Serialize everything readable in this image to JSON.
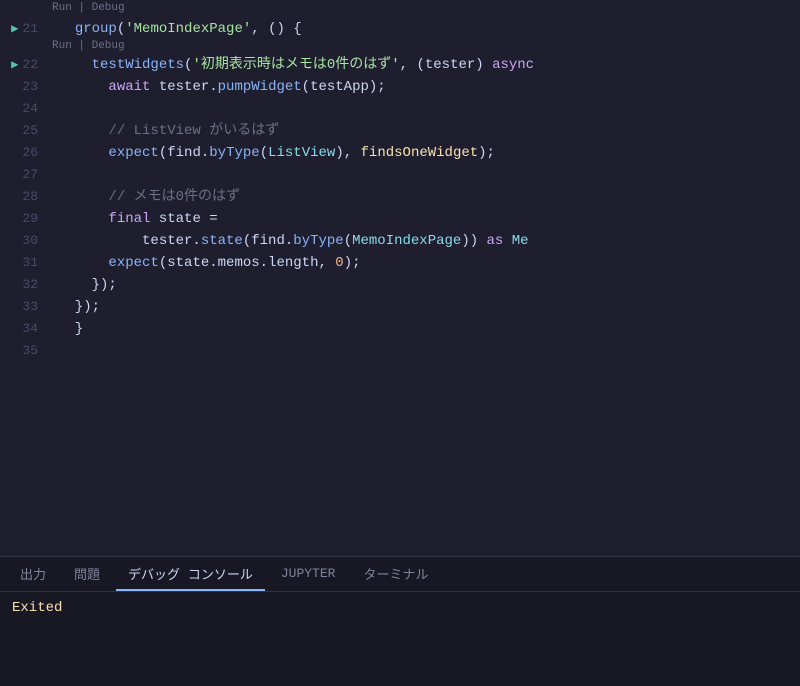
{
  "editor": {
    "lines": [
      {
        "number": 21,
        "hasArrow": true,
        "hasRunDebug": true,
        "runDebugText": "Run | Debug",
        "runDebugOffset": "above",
        "indent": 1,
        "tokens": [
          {
            "text": "group",
            "class": "kw-func"
          },
          {
            "text": "(",
            "class": "kw-paren"
          },
          {
            "text": "'MemoIndexPage'",
            "class": "kw-string"
          },
          {
            "text": ", () {",
            "class": "kw-plain"
          }
        ]
      },
      {
        "number": 22,
        "hasArrow": true,
        "hasRunDebug": true,
        "runDebugText": "Run | Debug",
        "indent": 2,
        "tokens": [
          {
            "text": "testWidgets",
            "class": "kw-func"
          },
          {
            "text": "(",
            "class": "kw-paren"
          },
          {
            "text": "'初期表示時はメモは0件のはず'",
            "class": "kw-string"
          },
          {
            "text": ", (tester) async",
            "class": "kw-plain kw-async"
          }
        ]
      },
      {
        "number": 23,
        "indent": 3,
        "tokens": [
          {
            "text": "await",
            "class": "kw-await"
          },
          {
            "text": " tester.",
            "class": "kw-tester"
          },
          {
            "text": "pumpWidget",
            "class": "kw-method"
          },
          {
            "text": "(testApp);",
            "class": "kw-plain"
          }
        ]
      },
      {
        "number": 24,
        "indent": 0,
        "tokens": []
      },
      {
        "number": 25,
        "indent": 3,
        "tokens": [
          {
            "text": "// ListView がいるはず",
            "class": "kw-comment"
          }
        ]
      },
      {
        "number": 26,
        "indent": 3,
        "tokens": [
          {
            "text": "expect",
            "class": "kw-func"
          },
          {
            "text": "(find.",
            "class": "kw-plain"
          },
          {
            "text": "byType",
            "class": "kw-method"
          },
          {
            "text": "(",
            "class": "kw-paren"
          },
          {
            "text": "ListView",
            "class": "kw-cyan"
          },
          {
            "text": "), ",
            "class": "kw-plain"
          },
          {
            "text": "findsOneWidget",
            "class": "kw-yellow"
          },
          {
            "text": ");",
            "class": "kw-plain"
          }
        ]
      },
      {
        "number": 27,
        "indent": 0,
        "tokens": []
      },
      {
        "number": 28,
        "indent": 3,
        "tokens": [
          {
            "text": "// メモは0件のはず",
            "class": "kw-comment"
          }
        ]
      },
      {
        "number": 29,
        "indent": 3,
        "tokens": [
          {
            "text": "final",
            "class": "kw-final"
          },
          {
            "text": " state =",
            "class": "kw-plain"
          }
        ]
      },
      {
        "number": 30,
        "indent": 4,
        "tokens": [
          {
            "text": "tester.",
            "class": "kw-tester"
          },
          {
            "text": "state",
            "class": "kw-method"
          },
          {
            "text": "(find.",
            "class": "kw-plain"
          },
          {
            "text": "byType",
            "class": "kw-method"
          },
          {
            "text": "(",
            "class": "kw-paren"
          },
          {
            "text": "MemoIndexPage",
            "class": "kw-cyan"
          },
          {
            "text": ")) ",
            "class": "kw-plain"
          },
          {
            "text": "as",
            "class": "kw-async"
          },
          {
            "text": " Me",
            "class": "kw-cyan"
          }
        ]
      },
      {
        "number": 31,
        "indent": 3,
        "tokens": [
          {
            "text": "expect",
            "class": "kw-func"
          },
          {
            "text": "(state.memos.length, ",
            "class": "kw-plain"
          },
          {
            "text": "0",
            "class": "kw-number"
          },
          {
            "text": ");",
            "class": "kw-plain"
          }
        ]
      },
      {
        "number": 32,
        "indent": 2,
        "tokens": [
          {
            "text": "});",
            "class": "kw-plain"
          }
        ]
      },
      {
        "number": 33,
        "indent": 1,
        "tokens": [
          {
            "text": "});",
            "class": "kw-plain"
          }
        ]
      },
      {
        "number": 34,
        "indent": 1,
        "tokens": [
          {
            "text": "}",
            "class": "kw-plain"
          }
        ]
      },
      {
        "number": 35,
        "indent": 0,
        "tokens": []
      }
    ]
  },
  "panel": {
    "tabs": [
      {
        "label": "出力",
        "active": false
      },
      {
        "label": "問題",
        "active": false
      },
      {
        "label": "デバッグ コンソール",
        "active": true
      },
      {
        "label": "JUPYTER",
        "active": false
      },
      {
        "label": "ターミナル",
        "active": false
      }
    ],
    "content": {
      "exitedText": "Exited"
    }
  }
}
